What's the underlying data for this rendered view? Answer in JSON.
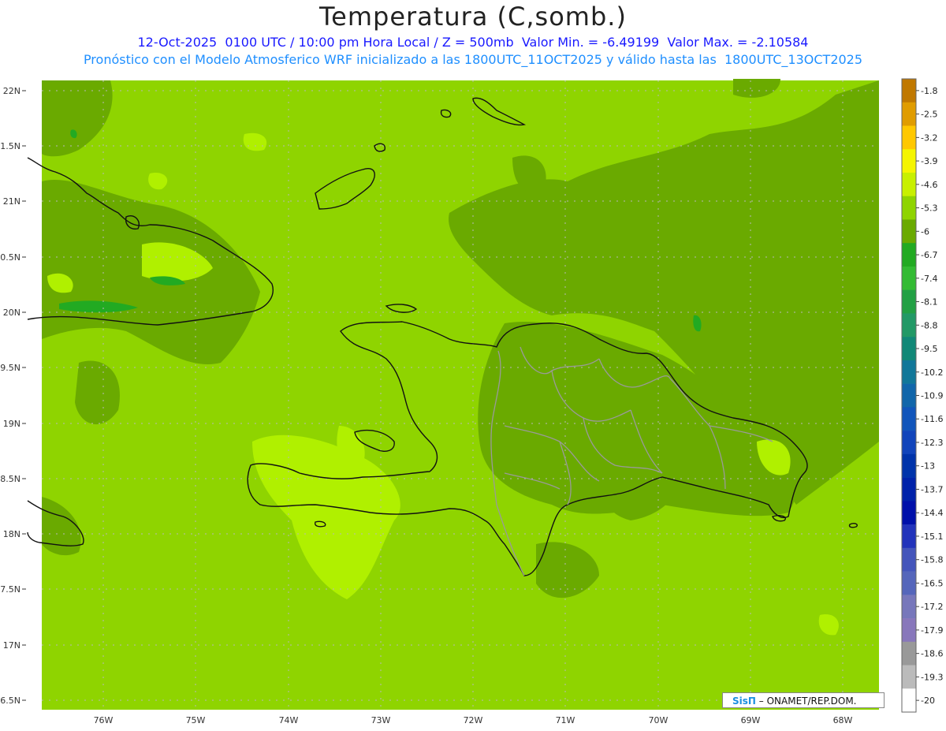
{
  "header": {
    "title": "Temperatura (C,somb.)",
    "line1": "12-Oct-2025  0100 UTC / 10:00 pm Hora Local / Z = 500mb  Valor Min. = -6.49199  Valor Max. = -2.10584",
    "line2": "Pronóstico con el Modelo Atmosferico WRF inicializado a las 1800UTC_11OCT2025 y válido hasta las  1800UTC_13OCT2025"
  },
  "axes": {
    "lat_labels": [
      "22N",
      "21.5N",
      "21N",
      "20.5N",
      "20N",
      "19.5N",
      "19N",
      "18.5N",
      "18N",
      "17.5N",
      "17N",
      "16.5N"
    ],
    "lon_labels": [
      "76W",
      "75W",
      "74W",
      "73W",
      "72W",
      "71W",
      "70W",
      "69W",
      "68W"
    ]
  },
  "colorbar": {
    "labels": [
      "-1.8",
      "-2.5",
      "-3.2",
      "-3.9",
      "-4.6",
      "-5.3",
      "-6",
      "-6.7",
      "-7.4",
      "-8.1",
      "-8.8",
      "-9.5",
      "-10.2",
      "-10.9",
      "-11.6",
      "-12.3",
      "-13",
      "-13.7",
      "-14.4",
      "-15.1",
      "-15.8",
      "-16.5",
      "-17.2",
      "-17.9",
      "-18.6",
      "-19.3",
      "-20"
    ],
    "colors": [
      "#c07800",
      "#e09c00",
      "#ffc800",
      "#f5f500",
      "#c8f000",
      "#8fd400",
      "#6aaa00",
      "#22aa22",
      "#33bb33",
      "#22a044",
      "#229966",
      "#118877",
      "#117799",
      "#1166aa",
      "#1155bb",
      "#1144bb",
      "#0033aa",
      "#0022aa",
      "#0010aa",
      "#2233bb",
      "#4455bb",
      "#5566bb",
      "#7777bb",
      "#8877bb",
      "#999999",
      "#bbbbbb",
      "#ffffff"
    ]
  },
  "field": {
    "base": "#8fd400",
    "dark": "#6aaa00",
    "light": "#b0f000",
    "green": "#22aa22"
  },
  "credit": {
    "sis": "SisΠ",
    "text": "– ONAMET/REP.DOM."
  }
}
